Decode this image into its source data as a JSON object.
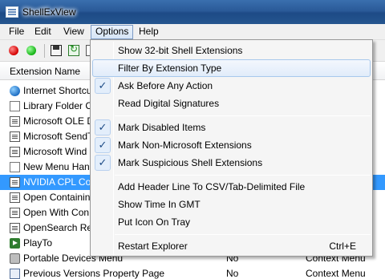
{
  "window": {
    "title": "ShellExView"
  },
  "menubar": {
    "items": [
      {
        "label": "File"
      },
      {
        "label": "Edit"
      },
      {
        "label": "View"
      },
      {
        "label": "Options"
      },
      {
        "label": "Help"
      }
    ]
  },
  "toolbar": {
    "buttons": [
      "red-circle-icon",
      "green-circle-icon",
      "save-icon",
      "refresh-icon",
      "copy-icon"
    ]
  },
  "list": {
    "columns": [
      {
        "label": "Extension Name"
      }
    ],
    "rows": [
      {
        "name": "Internet Shortcu",
        "c2": "",
        "c3": ""
      },
      {
        "name": "Library Folder C",
        "c2": "",
        "c3": ""
      },
      {
        "name": "Microsoft OLE D",
        "c2": "",
        "c3": ""
      },
      {
        "name": "Microsoft SendT",
        "c2": "",
        "c3": ""
      },
      {
        "name": "Microsoft Wind",
        "c2": "",
        "c3": ""
      },
      {
        "name": "New Menu Han",
        "c2": "",
        "c3": ""
      },
      {
        "name": "NVIDIA CPL Co",
        "c2": "",
        "c3": ""
      },
      {
        "name": "Open Containin",
        "c2": "",
        "c3": ""
      },
      {
        "name": "Open With Con",
        "c2": "",
        "c3": ""
      },
      {
        "name": "OpenSearch Re",
        "c2": "",
        "c3": ""
      },
      {
        "name": "PlayTo",
        "c2": "",
        "c3": ""
      },
      {
        "name": "Portable Devices Menu",
        "c2": "No",
        "c3": "Context Menu"
      },
      {
        "name": "Previous Versions Property Page",
        "c2": "No",
        "c3": "Context Menu"
      }
    ]
  },
  "options_menu": {
    "items": [
      {
        "label": "Show 32-bit Shell Extensions",
        "checked": false
      },
      {
        "label": "Filter By Extension Type",
        "checked": false
      },
      {
        "label": "Ask Before Any Action",
        "checked": true
      },
      {
        "label": "Read Digital Signatures",
        "checked": false
      },
      {
        "label": "Mark Disabled Items",
        "checked": true
      },
      {
        "label": "Mark Non-Microsoft Extensions",
        "checked": true
      },
      {
        "label": "Mark Suspicious Shell Extensions",
        "checked": true
      },
      {
        "label": "Add Header Line To CSV/Tab-Delimited File",
        "checked": false
      },
      {
        "label": "Show Time In GMT",
        "checked": false
      },
      {
        "label": "Put Icon On Tray",
        "checked": false
      },
      {
        "label": "Restart Explorer",
        "checked": false,
        "shortcut": "Ctrl+E"
      }
    ]
  },
  "colors": {
    "selection": "#3399ff",
    "menu_highlight": "#e1ecfa",
    "titlebar": "#2a5a98"
  }
}
